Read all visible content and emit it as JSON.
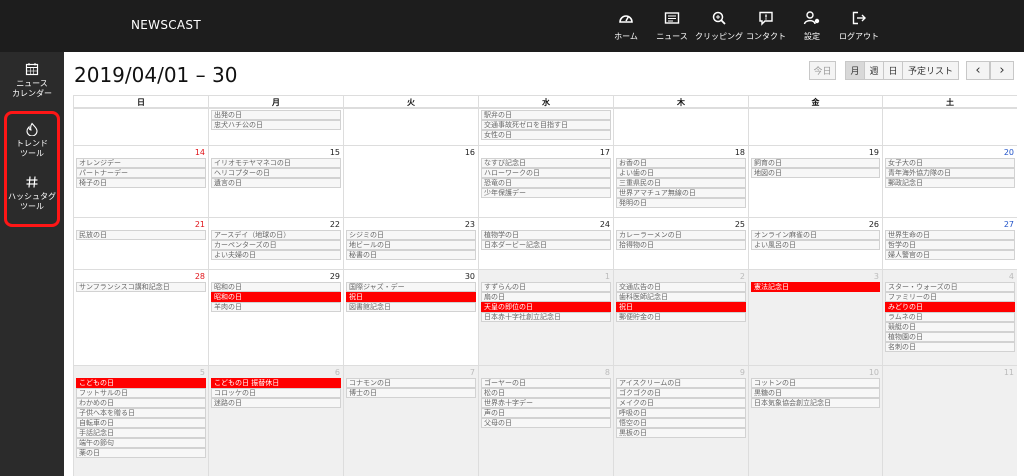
{
  "brand": "NEWSCAST",
  "nav": [
    {
      "label": "ホーム",
      "icon": "dashboard-icon"
    },
    {
      "label": "ニュース",
      "icon": "newspaper-icon"
    },
    {
      "label": "クリッピング",
      "icon": "magnify-icon"
    },
    {
      "label": "コンタクト",
      "icon": "message-icon"
    },
    {
      "label": "設定",
      "icon": "user-settings-icon"
    },
    {
      "label": "ログアウト",
      "icon": "logout-icon"
    }
  ],
  "sidebar": [
    {
      "label": "ニュース\nカレンダー",
      "icon": "calendar-icon"
    },
    {
      "label": "トレンド\nツール",
      "icon": "trend-icon"
    },
    {
      "label": "ハッシュタグ\nツール",
      "icon": "hashtag-icon"
    }
  ],
  "title": "2019/04/01 – 30",
  "toolbar": {
    "today": "今日",
    "month": "月",
    "week": "週",
    "day": "日",
    "list": "予定リスト",
    "prev": "‹",
    "next": "›"
  },
  "weekdays": [
    "日",
    "月",
    "火",
    "水",
    "木",
    "金",
    "土"
  ],
  "weeks": [
    [
      {
        "num": "",
        "events": []
      },
      {
        "num": "",
        "events": [
          [
            "出発の日",
            0
          ],
          [
            "忠犬ハチ公の日",
            0
          ]
        ]
      },
      {
        "num": "",
        "events": []
      },
      {
        "num": "",
        "events": [
          [
            "駅弁の日",
            0
          ],
          [
            "交通事故死ゼロを目指す日",
            0
          ],
          [
            "女性の日",
            0
          ]
        ]
      },
      {
        "num": "",
        "events": []
      },
      {
        "num": "",
        "events": []
      },
      {
        "num": "",
        "events": []
      }
    ],
    [
      {
        "num": "14",
        "events": [
          [
            "オレンジデー",
            0
          ],
          [
            "パートナーデー",
            0
          ],
          [
            "椅子の日",
            0
          ]
        ]
      },
      {
        "num": "15",
        "events": [
          [
            "イリオモテヤマネコの日",
            0
          ],
          [
            "ヘリコプターの日",
            0
          ],
          [
            "遺言の日",
            0
          ]
        ]
      },
      {
        "num": "16",
        "events": []
      },
      {
        "num": "17",
        "events": [
          [
            "なすび記念日",
            0
          ],
          [
            "ハローワークの日",
            0
          ],
          [
            "恐竜の日",
            0
          ],
          [
            "少年保護デー",
            0
          ]
        ]
      },
      {
        "num": "18",
        "events": [
          [
            "お香の日",
            0
          ],
          [
            "よい歯の日",
            0
          ],
          [
            "三重県民の日",
            0
          ],
          [
            "世界アマチュア無線の日",
            0
          ],
          [
            "発明の日",
            0
          ]
        ]
      },
      {
        "num": "19",
        "events": [
          [
            "飼育の日",
            0
          ],
          [
            "地図の日",
            0
          ]
        ]
      },
      {
        "num": "20",
        "events": [
          [
            "女子大の日",
            0
          ],
          [
            "青年海外協力隊の日",
            0
          ],
          [
            "郵政記念日",
            0
          ]
        ]
      }
    ],
    [
      {
        "num": "21",
        "events": [
          [
            "民放の日",
            0
          ]
        ]
      },
      {
        "num": "22",
        "events": [
          [
            "アースデイ（地球の日）",
            0
          ],
          [
            "カーペンターズの日",
            0
          ],
          [
            "よい夫婦の日",
            0
          ]
        ]
      },
      {
        "num": "23",
        "events": [
          [
            "シジミの日",
            0
          ],
          [
            "地ビールの日",
            0
          ],
          [
            "秘書の日",
            0
          ]
        ]
      },
      {
        "num": "24",
        "events": [
          [
            "植物学の日",
            0
          ],
          [
            "日本ダービー記念日",
            0
          ]
        ]
      },
      {
        "num": "25",
        "events": [
          [
            "カレーラーメンの日",
            0
          ],
          [
            "拾得物の日",
            0
          ]
        ]
      },
      {
        "num": "26",
        "events": [
          [
            "オンライン麻雀の日",
            0
          ],
          [
            "よい風呂の日",
            0
          ]
        ]
      },
      {
        "num": "27",
        "events": [
          [
            "世界生命の日",
            0
          ],
          [
            "哲学の日",
            0
          ],
          [
            "婦人警官の日",
            0
          ]
        ]
      }
    ],
    [
      {
        "num": "28",
        "events": [
          [
            "サンフランシスコ講和記念日",
            0
          ]
        ]
      },
      {
        "num": "29",
        "events": [
          [
            "昭和の日",
            0
          ],
          [
            "昭和の日",
            1
          ],
          [
            "羊肉の日",
            0
          ]
        ]
      },
      {
        "num": "30",
        "events": [
          [
            "国際ジャズ・デー",
            0
          ],
          [
            "祝日",
            1
          ],
          [
            "図書館記念日",
            0
          ]
        ]
      },
      {
        "num": "1",
        "events": [
          [
            "すずらんの日",
            0
          ],
          [
            "扇の日",
            0
          ],
          [
            "天皇の即位の日",
            1
          ],
          [
            "日本赤十字社創立記念日",
            0
          ]
        ]
      },
      {
        "num": "2",
        "events": [
          [
            "交通広告の日",
            0
          ],
          [
            "歯科医師記念日",
            0
          ],
          [
            "祝日",
            1
          ],
          [
            "郵便貯金の日",
            0
          ]
        ]
      },
      {
        "num": "3",
        "events": [
          [
            "憲法記念日",
            1
          ]
        ]
      },
      {
        "num": "4",
        "events": [
          [
            "スター・ウォーズの日",
            0
          ],
          [
            "ファミリーの日",
            0
          ],
          [
            "みどりの日",
            1
          ],
          [
            "ラムネの日",
            0
          ],
          [
            "競艇の日",
            0
          ],
          [
            "植物園の日",
            0
          ],
          [
            "名刺の日",
            0
          ]
        ]
      }
    ],
    [
      {
        "num": "5",
        "events": [
          [
            "こどもの日",
            1
          ],
          [
            "フットサルの日",
            0
          ],
          [
            "わかめの日",
            0
          ],
          [
            "子供へ本を贈る日",
            0
          ],
          [
            "自転車の日",
            0
          ],
          [
            "手話記念日",
            0
          ],
          [
            "端午の節句",
            0
          ],
          [
            "薬の日",
            0
          ]
        ]
      },
      {
        "num": "6",
        "events": [
          [
            "こどもの日 振替休日",
            1
          ],
          [
            "コロッケの日",
            0
          ],
          [
            "迷路の日",
            0
          ]
        ]
      },
      {
        "num": "7",
        "events": [
          [
            "コナモンの日",
            0
          ],
          [
            "博士の日",
            0
          ]
        ]
      },
      {
        "num": "8",
        "events": [
          [
            "ゴーヤーの日",
            0
          ],
          [
            "松の日",
            0
          ],
          [
            "世界赤十字デー",
            0
          ],
          [
            "声の日",
            0
          ],
          [
            "父母の日",
            0
          ]
        ]
      },
      {
        "num": "9",
        "events": [
          [
            "アイスクリームの日",
            0
          ],
          [
            "ゴクゴクの日",
            0
          ],
          [
            "メイクの日",
            0
          ],
          [
            "呼吸の日",
            0
          ],
          [
            "悟空の日",
            0
          ],
          [
            "黒板の日",
            0
          ]
        ]
      },
      {
        "num": "10",
        "events": [
          [
            "コットンの日",
            0
          ],
          [
            "黒糖の日",
            0
          ],
          [
            "日本気象協会創立記念日",
            0
          ]
        ]
      },
      {
        "num": "11",
        "events": []
      }
    ]
  ]
}
